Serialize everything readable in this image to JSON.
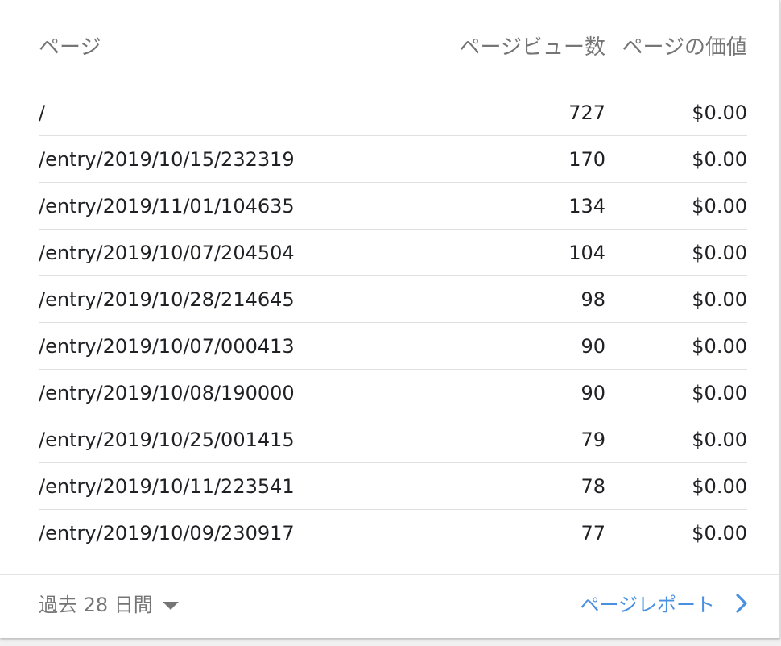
{
  "table": {
    "headers": {
      "page": "ページ",
      "views": "ページビュー数",
      "value": "ページの価値"
    },
    "rows": [
      {
        "page": "/",
        "views": "727",
        "value": "$0.00"
      },
      {
        "page": "/entry/2019/10/15/232319",
        "views": "170",
        "value": "$0.00"
      },
      {
        "page": "/entry/2019/11/01/104635",
        "views": "134",
        "value": "$0.00"
      },
      {
        "page": "/entry/2019/10/07/204504",
        "views": "104",
        "value": "$0.00"
      },
      {
        "page": "/entry/2019/10/28/214645",
        "views": "98",
        "value": "$0.00"
      },
      {
        "page": "/entry/2019/10/07/000413",
        "views": "90",
        "value": "$0.00"
      },
      {
        "page": "/entry/2019/10/08/190000",
        "views": "90",
        "value": "$0.00"
      },
      {
        "page": "/entry/2019/10/25/001415",
        "views": "79",
        "value": "$0.00"
      },
      {
        "page": "/entry/2019/10/11/223541",
        "views": "78",
        "value": "$0.00"
      },
      {
        "page": "/entry/2019/10/09/230917",
        "views": "77",
        "value": "$0.00"
      }
    ]
  },
  "footer": {
    "date_range": "過去 28 日間",
    "date_range_icon": "caret-down-icon",
    "report_link": "ページレポート",
    "report_icon": "chevron-right-icon"
  },
  "colors": {
    "link": "#4a90e2",
    "muted": "#757575",
    "text": "#202124",
    "divider": "#e0e0e0"
  }
}
